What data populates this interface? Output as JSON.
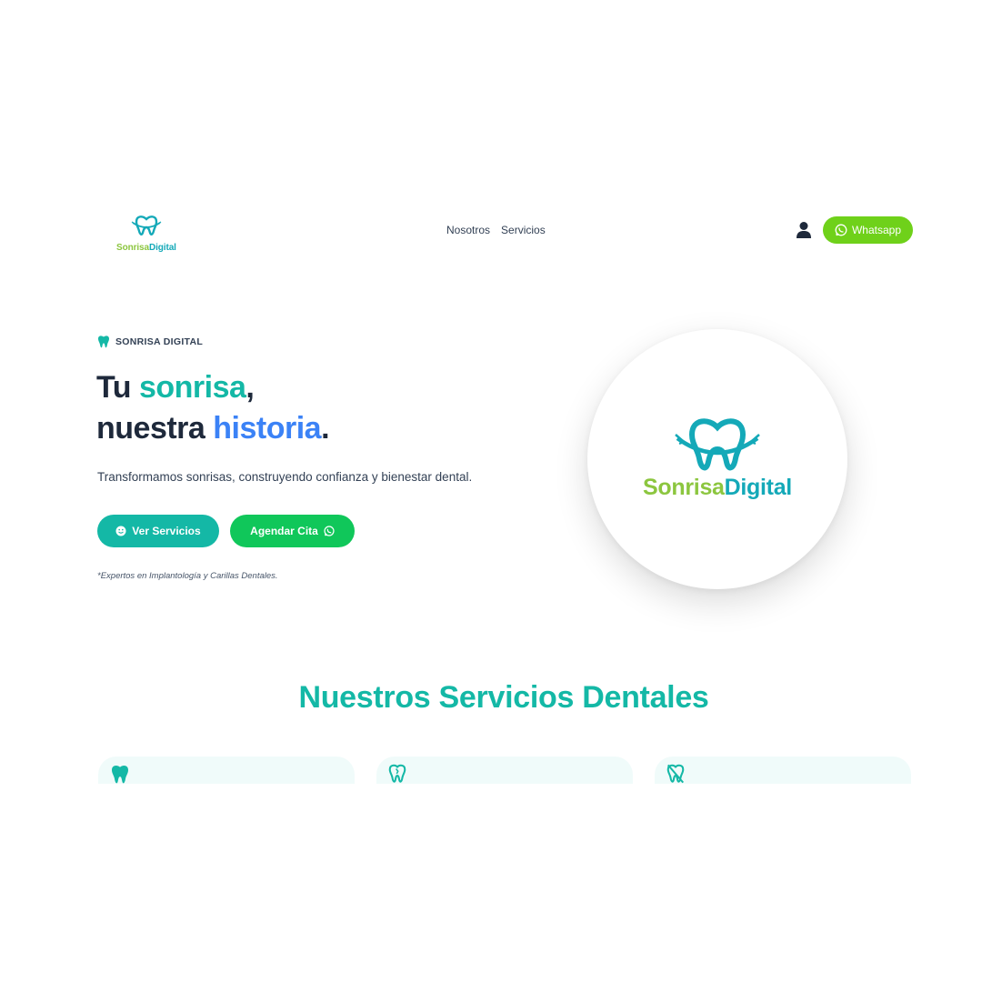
{
  "header": {
    "logo": {
      "part1": "Sonrisa",
      "part2": "Digital"
    },
    "nav": [
      {
        "label": "Nosotros"
      },
      {
        "label": "Servicios"
      }
    ],
    "whatsapp_label": "Whatsapp"
  },
  "hero": {
    "kicker": "SONRISA DIGITAL",
    "headline": {
      "line1_a": "Tu ",
      "line1_b": "sonrisa",
      "line1_c": ",",
      "line2_a": "nuestra ",
      "line2_b": "historia",
      "line2_c": "."
    },
    "lead": "Transformamos sonrisas, construyendo confianza y bienestar dental.",
    "primary_button": "Ver Servicios",
    "secondary_button": "Agendar Cita",
    "note": "*Expertos en Implantología y Carillas Dentales.",
    "circle_logo": {
      "part1": "Sonrisa",
      "part2": "Digital"
    }
  },
  "services": {
    "title": "Nuestros Servicios Dentales",
    "cards": [
      {
        "icon": "tooth-icon"
      },
      {
        "icon": "tooth-outline-icon"
      },
      {
        "icon": "tooth-slash-icon"
      }
    ]
  },
  "colors": {
    "teal": "#14b8a6",
    "blue": "#3b82f6",
    "whatsapp_green": "#6fd11a",
    "cta_green": "#10c75a",
    "logo_green": "#8cc63f",
    "logo_teal": "#14a9b8"
  }
}
